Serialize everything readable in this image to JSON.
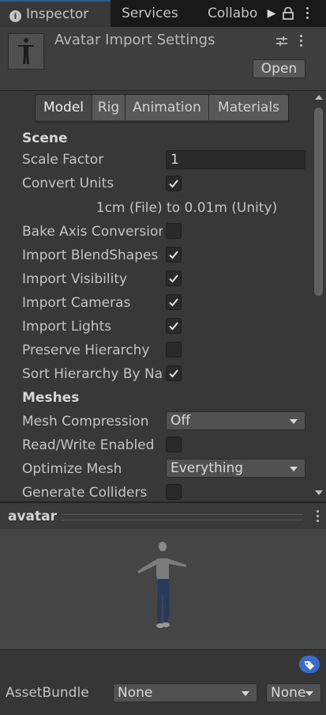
{
  "tabs": {
    "inspector": "Inspector",
    "services": "Services",
    "collab": "Collabo"
  },
  "header": {
    "title": "Avatar Import Settings",
    "open_label": "Open"
  },
  "segments": [
    "Model",
    "Rig",
    "Animation",
    "Materials"
  ],
  "model": {
    "scene_section": "Scene",
    "scale_factor": {
      "label": "Scale Factor",
      "value": "1"
    },
    "convert_units": {
      "label": "Convert Units",
      "checked": true
    },
    "units_note": "1cm (File) to 0.01m (Unity)",
    "bake_axis": {
      "label": "Bake Axis Conversion",
      "checked": false
    },
    "import_blendshapes": {
      "label": "Import BlendShapes",
      "checked": true
    },
    "import_visibility": {
      "label": "Import Visibility",
      "checked": true
    },
    "import_cameras": {
      "label": "Import Cameras",
      "checked": true
    },
    "import_lights": {
      "label": "Import Lights",
      "checked": true
    },
    "preserve_hierarchy": {
      "label": "Preserve Hierarchy",
      "checked": false
    },
    "sort_hierarchy": {
      "label": "Sort Hierarchy By Name",
      "checked": true
    },
    "meshes_section": "Meshes",
    "mesh_compression": {
      "label": "Mesh Compression",
      "value": "Off"
    },
    "read_write": {
      "label": "Read/Write Enabled",
      "checked": false
    },
    "optimize_mesh": {
      "label": "Optimize Mesh",
      "value": "Everything"
    },
    "generate_colliders": {
      "label": "Generate Colliders",
      "checked": false
    }
  },
  "preview": {
    "title": "avatar"
  },
  "asset_bundle": {
    "label": "AssetBundle",
    "name": "None",
    "variant": "None"
  },
  "colors": {
    "background": "#383838",
    "tab_accent": "#2c5d87",
    "tag_icon": "#3a6cc7"
  }
}
